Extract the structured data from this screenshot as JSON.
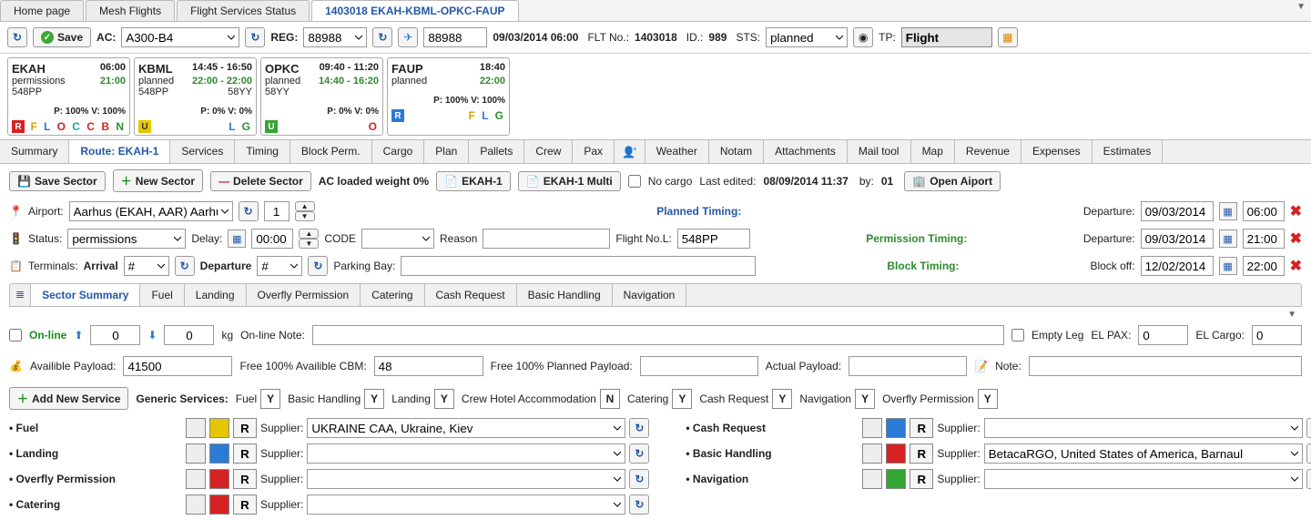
{
  "tabs_top": [
    "Home page",
    "Mesh Flights",
    "Flight Services Status",
    "1403018 EKAH-KBML-OPKC-FAUP"
  ],
  "tabs_top_active": 3,
  "toolbar": {
    "save": "Save",
    "ac": "AC:",
    "ac_val": "A300-B4",
    "reg": "REG:",
    "reg_val": "88988",
    "plane_val": "88988",
    "date": "09/03/2014 06:00",
    "flt": "FLT No.:",
    "flt_val": "1403018",
    "id": "ID.:",
    "id_val": "989",
    "sts": "STS:",
    "sts_val": "planned",
    "tp": "TP:",
    "tp_val": "Flight"
  },
  "legs": [
    {
      "code": "EKAH",
      "time": "06:00",
      "status": "permissions",
      "t2": "21:00",
      "flno": "548PP",
      "pv": "P: 100% V: 100%",
      "sq": "R",
      "sqcls": "red",
      "flags": [
        "F",
        "L",
        "O",
        "C",
        "C",
        "B",
        "N"
      ],
      "flagcls": [
        "f-F",
        "f-L",
        "f-O",
        "f-C1",
        "f-C2",
        "f-B",
        "f-N"
      ]
    },
    {
      "code": "KBML",
      "time": "14:45 - 16:50",
      "status": "planned",
      "t2": "22:00 - 22:00",
      "flno": "548PP",
      "extra": "58YY",
      "pv": "P: 0% V: 0%",
      "sq": "U",
      "sqcls": "yellow",
      "flags": [
        "L",
        "G"
      ],
      "flagcls": [
        "f-L",
        "f-N"
      ]
    },
    {
      "code": "OPKC",
      "time": "09:40 - 11:20",
      "status": "planned",
      "t2": "14:40 - 16:20",
      "flno": "58YY",
      "pv": "P: 0% V: 0%",
      "sq": "U",
      "sqcls": "greenb",
      "flags": [
        "O"
      ],
      "flagcls": [
        "f-O"
      ]
    },
    {
      "code": "FAUP",
      "time": "18:40",
      "status": "planned",
      "t2": "22:00",
      "flno": "",
      "pv": "P: 100% V: 100%",
      "sq": "R",
      "sqcls": "blue",
      "flags": [
        "F",
        "L",
        "G"
      ],
      "flagcls": [
        "f-F",
        "f-L",
        "f-N"
      ]
    }
  ],
  "tabs2": [
    "Summary",
    "Route: EKAH-1",
    "Services",
    "Timing",
    "Block Perm.",
    "Cargo",
    "Plan",
    "Pallets",
    "Crew",
    "Pax",
    "",
    "Weather",
    "Notam",
    "Attachments",
    "Mail tool",
    "Map",
    "Revenue",
    "Expenses",
    "Estimates"
  ],
  "tabs2_active": 1,
  "sectorbar": {
    "save": "Save Sector",
    "new": "New Sector",
    "del": "Delete Sector",
    "weight": "AC loaded weight 0%",
    "doc1": "EKAH-1",
    "doc2": "EKAH-1 Multi",
    "nocargo": "No cargo",
    "lastedit_l": "Last edited:",
    "lastedit_v": "08/09/2014 11:37",
    "by_l": "by:",
    "by_v": "01",
    "open": "Open Aiport"
  },
  "row_airport": {
    "lbl": "Airport:",
    "val": "Aarhus (EKAH, AAR) Aarhu",
    "num": "1",
    "planned": "Planned Timing:",
    "dep_l": "Departure:",
    "dep_d": "09/03/2014",
    "dep_t": "06:00"
  },
  "row_status": {
    "lbl": "Status:",
    "val": "permissions",
    "delay": "Delay:",
    "delay_v": "00:00",
    "code": "CODE",
    "reason": "Reason",
    "flno_l": "Flight No.L:",
    "flno_v": "548PP",
    "perm": "Permission Timing:",
    "dep_l": "Departure:",
    "dep_d": "09/03/2014",
    "dep_t": "21:00"
  },
  "row_term": {
    "lbl": "Terminals:",
    "arr": "Arrival",
    "arr_v": "#",
    "dep": "Departure",
    "dep_v": "#",
    "park": "Parking Bay:",
    "block": "Block Timing:",
    "blk_l": "Block off:",
    "blk_d": "12/02/2014",
    "blk_t": "22:00"
  },
  "tabs3": [
    "Sector Summary",
    "Fuel",
    "Landing",
    "Overfly Permission",
    "Catering",
    "Cash Request",
    "Basic Handling",
    "Navigation"
  ],
  "tabs3_active": 0,
  "summary": {
    "online": "On-line",
    "fuel_up": "0",
    "fuel_dn": "0",
    "kg": "kg",
    "onnote": "On-line Note:",
    "empty": "Empty Leg",
    "elpax": "EL PAX:",
    "elpax_v": "0",
    "elcargo": "EL Cargo:",
    "elcargo_v": "0",
    "avail": "Availible Payload:",
    "avail_v": "41500",
    "cbm": "Free 100% Availible CBM:",
    "cbm_v": "48",
    "planned": "Free 100% Planned Payload:",
    "actual": "Actual Payload:",
    "note": "Note:"
  },
  "generic": {
    "add": "Add New Service",
    "lbl": "Generic Services:",
    "items": [
      [
        "Fuel",
        "Y"
      ],
      [
        "Basic Handling",
        "Y"
      ],
      [
        "Landing",
        "Y"
      ],
      [
        "Crew Hotel Accommodation",
        "N"
      ],
      [
        "Catering",
        "Y"
      ],
      [
        "Cash Request",
        "Y"
      ],
      [
        "Navigation",
        "Y"
      ],
      [
        "Overfly Permission",
        "Y"
      ]
    ]
  },
  "services_left": [
    {
      "name": "Fuel",
      "color": "cb-yellow",
      "supplier": "UKRAINE CAA, Ukraine, Kiev"
    },
    {
      "name": "Landing",
      "color": "cb-blue",
      "supplier": ""
    },
    {
      "name": "Overfly Permission",
      "color": "cb-red",
      "supplier": ""
    },
    {
      "name": "Catering",
      "color": "cb-red",
      "supplier": ""
    }
  ],
  "services_right": [
    {
      "name": "Cash Request",
      "color": "cb-blue",
      "supplier": ""
    },
    {
      "name": "Basic Handling",
      "color": "cb-red",
      "supplier": "BetacaRGO, United States of America, Barnaul"
    },
    {
      "name": "Navigation",
      "color": "cb-green",
      "supplier": ""
    }
  ],
  "labels": {
    "supplier": "Supplier:",
    "r": "R"
  }
}
